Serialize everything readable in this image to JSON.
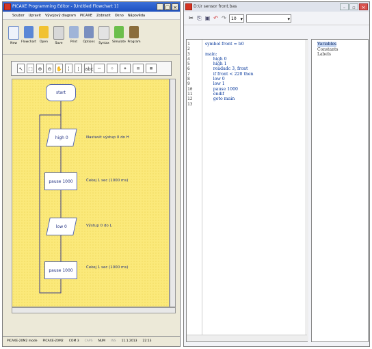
{
  "left_window": {
    "title": "PICAXE Programming Editor - [Untitled Flowchart 1]",
    "menu": [
      "Soubor",
      "Upravit",
      "Vývojový diagram",
      "PICAXE",
      "Zobrazit",
      "Okno",
      "Nápověda"
    ],
    "toolbar": [
      "New",
      "Flowchart",
      "Open",
      "Save",
      "Print",
      "Options",
      "Syntax",
      "Simulate",
      "Program"
    ],
    "flowchart": {
      "start": "start",
      "blocks": [
        {
          "label": "high 0",
          "note": "Nastavit výstup 0 do H"
        },
        {
          "label": "pause 1000",
          "note": "Čekej 1 sec (1000 ms)"
        },
        {
          "label": "low 0",
          "note": "Výstup 0 do L"
        },
        {
          "label": "pause 1000",
          "note": "Čekej 1 sec (1000 ms)"
        }
      ]
    },
    "status": [
      "PICAXE-20M2 mode",
      "PICAXE-20M2",
      "COM 3",
      "CAPS",
      "NUM",
      "INS",
      "11.1.2013",
      "22:13"
    ]
  },
  "right_window": {
    "title": "D:\\ir sensor front.bas",
    "font_size": "10",
    "line_numbers": [
      "1",
      "2",
      "3",
      "4",
      "5",
      "6",
      "7",
      "8",
      "9",
      "10",
      "11",
      "12",
      "13"
    ],
    "code": "symbol front = b0\n\nmain:\n      high 0\n      high 1\n      readadc 3, front\n      if front < 220 then\n      low 0\n      low 1\n      pause 1000\n      endif\n      goto main",
    "panel": [
      "Variables",
      "Constants",
      "Labels"
    ]
  }
}
